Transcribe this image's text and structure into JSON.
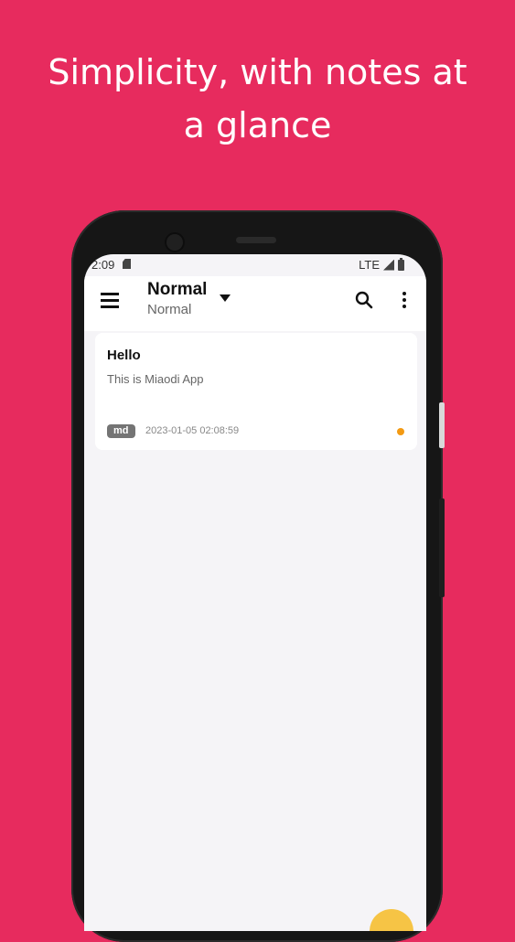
{
  "headline": {
    "line1": "Simplicity, with notes at",
    "line2": "a glance"
  },
  "statusbar": {
    "time": "2:09",
    "network": "LTE"
  },
  "appbar": {
    "title": "Normal",
    "subtitle": "Normal",
    "icons": [
      "menu-icon",
      "chevron-down-icon",
      "search-icon",
      "more-vert-icon"
    ]
  },
  "notes": [
    {
      "title": "Hello",
      "body": "This is Miaodi App",
      "badge": "md",
      "timestamp": "2023-01-05 02:08:59",
      "dot_color": "#f39a13"
    }
  ],
  "colors": {
    "background": "#e72b5e",
    "screen": "#f5f4f7",
    "fab": "#f6c445"
  }
}
